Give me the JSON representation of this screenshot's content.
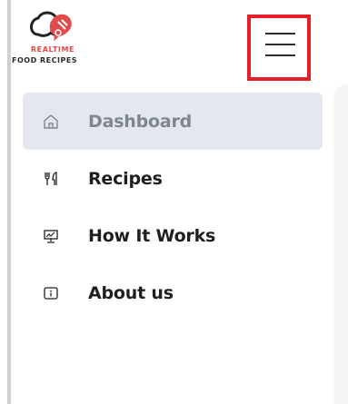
{
  "brand": {
    "line1": "REALTIME",
    "line2": "FOOD RECIPES",
    "logo_icon": "recipe-logo-icon",
    "accent_color": "#e24b4b"
  },
  "header": {
    "menu_toggle_icon": "hamburger-menu-icon",
    "highlight_color": "#e5202a"
  },
  "sidebar": {
    "items": [
      {
        "label": "Dashboard",
        "icon": "home-icon",
        "active": true
      },
      {
        "label": "Recipes",
        "icon": "fork-knife-icon",
        "active": false
      },
      {
        "label": "How It Works",
        "icon": "presentation-icon",
        "active": false
      },
      {
        "label": "About us",
        "icon": "info-icon",
        "active": false
      }
    ],
    "active_bg": "#e4e8ee"
  }
}
